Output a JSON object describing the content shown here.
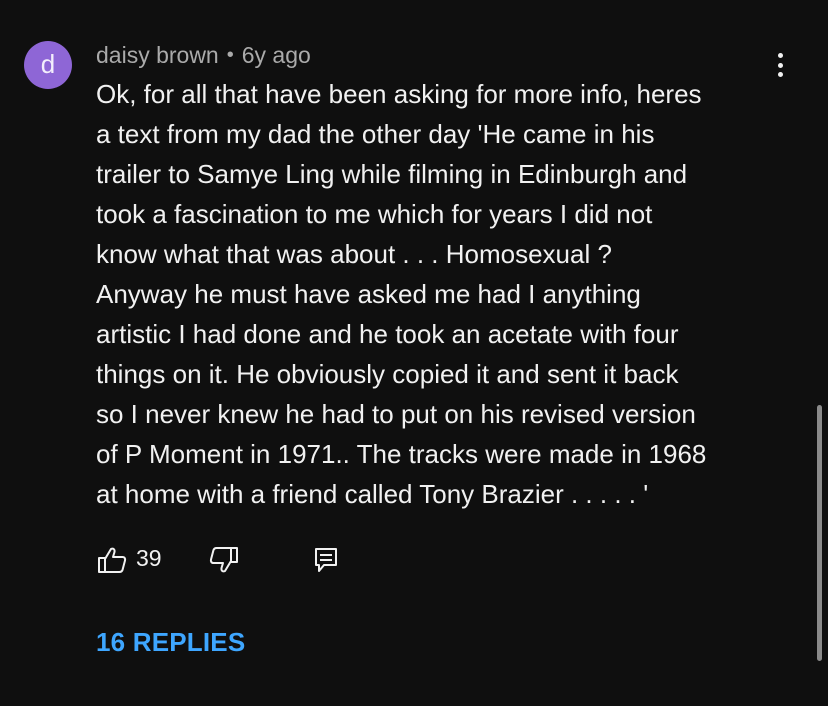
{
  "comment": {
    "avatar_letter": "d",
    "avatar_color": "#8e66d6",
    "author": "daisy brown",
    "separator": "•",
    "time": "6y ago",
    "menu_icon": "more-vertical-icon",
    "text_lines": [
      "Ok, for all that have been asking for more info, heres",
      "a text from my dad the other day 'He came in his",
      "trailer to Samye Ling while filming in Edinburgh and",
      "took a fascination to me which for years I did not",
      "know what that was about . . . Homosexual ?",
      "Anyway he must have asked me had I anything",
      "artistic I had done and he took an acetate with four",
      "things on it. He obviously copied it and sent it back",
      "so I never knew he had to put on his revised version",
      "of P Moment in 1971.. The tracks were made in 1968",
      "at home with a friend called Tony Brazier . . . . . '"
    ]
  },
  "actions": {
    "like_icon": "thumbs-up-icon",
    "like_count": "39",
    "dislike_icon": "thumbs-down-icon",
    "reply_icon": "reply-comment-icon"
  },
  "replies": {
    "label": "16 REPLIES",
    "color": "#3ea6ff"
  }
}
